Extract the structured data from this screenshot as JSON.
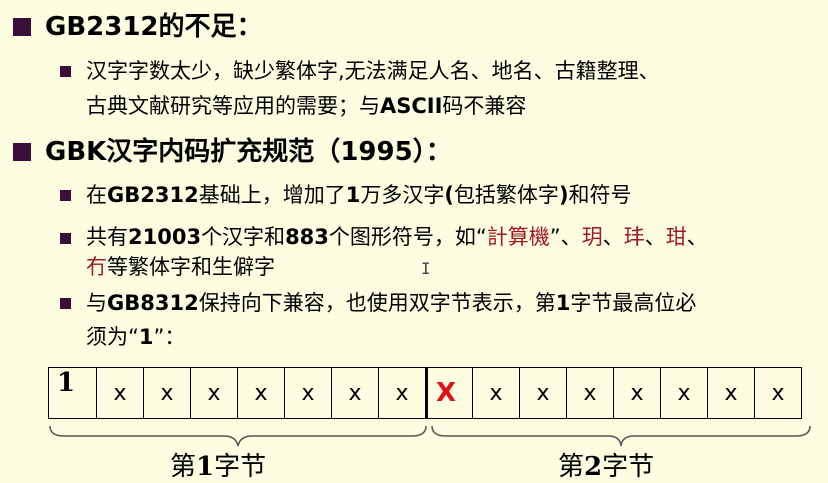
{
  "section1": {
    "heading": "GB2312的不足：",
    "items": [
      {
        "lines": [
          "汉字字数太少，缺少繁体字,无法满足人名、地名、古籍整理、",
          "古典文献研究等应用的需要；与",
          "ASCII",
          "码不兼容"
        ]
      }
    ]
  },
  "section2": {
    "heading_prefix": "GBK汉字内码扩充规范（",
    "heading_year": "1995",
    "heading_suffix": "）：",
    "item1": {
      "a": "在",
      "b": "GB2312",
      "c": "基础上，增加了",
      "d": "1",
      "e": "万多汉字",
      "f": "(",
      "g": "包括繁体字",
      "h": ")",
      "i": "和符号"
    },
    "item2": {
      "a": "共有",
      "b": "21003",
      "c": "个汉字和",
      "d": "883",
      "e": "个图形符号，如“",
      "f": "計算機",
      "g": "”、",
      "h": "玥",
      "i": "、",
      "j": "玤",
      "k": "、",
      "l": "玵",
      "m": "、",
      "n": "冇",
      "o": "等繁体字和生僻字"
    },
    "item3": {
      "a": "与",
      "b": "GB8312",
      "c": "保持向下兼容，也使用双字节表示，第",
      "d": "1",
      "e": "字节最高位必",
      "f": "须为“",
      "g": "1",
      "h": "”："
    }
  },
  "cursor_glyph": "I",
  "byte_cells": {
    "byte1": [
      "1",
      "x",
      "x",
      "x",
      "x",
      "x",
      "x",
      "x"
    ],
    "byte2": [
      "X",
      "x",
      "x",
      "x",
      "x",
      "x",
      "x",
      "x"
    ]
  },
  "labels": {
    "byte1_pre": "第",
    "byte1_num": "1",
    "byte1_post": "字节",
    "byte2_pre": "第",
    "byte2_num": "2",
    "byte2_post": "字节"
  },
  "colors": {
    "background": "#fdfde2",
    "bullet": "#3c0f3a",
    "highlight": "#a01820",
    "red_x": "#e0101a"
  }
}
